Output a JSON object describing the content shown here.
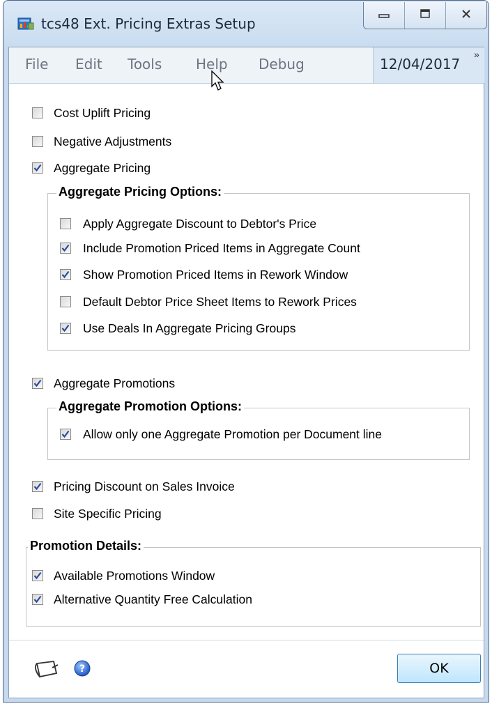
{
  "window": {
    "title": "tcs48 Ext. Pricing Extras Setup",
    "icon": "pricing-app-icon"
  },
  "menu": {
    "items": [
      "File",
      "Edit",
      "Tools",
      "Help",
      "Debug"
    ],
    "date": "12/04/2017",
    "overflow": "»"
  },
  "options": {
    "cost_uplift": {
      "label": "Cost Uplift Pricing",
      "checked": false
    },
    "negative_adjustments": {
      "label": "Negative Adjustments",
      "checked": false
    },
    "aggregate_pricing": {
      "label": "Aggregate Pricing",
      "checked": true
    }
  },
  "aggregate_pricing_options": {
    "title": "Aggregate Pricing Options:",
    "items": [
      {
        "label": "Apply Aggregate Discount to Debtor's Price",
        "checked": false
      },
      {
        "label": "Include Promotion Priced Items in Aggregate Count",
        "checked": true
      },
      {
        "label": "Show Promotion Priced Items in Rework Window",
        "checked": true
      },
      {
        "label": "Default Debtor Price Sheet Items to Rework Prices",
        "checked": false
      },
      {
        "label": "Use Deals In Aggregate Pricing Groups",
        "checked": true
      }
    ]
  },
  "aggregate_promotions": {
    "label": "Aggregate Promotions",
    "checked": true
  },
  "aggregate_promotion_options": {
    "title": "Aggregate Promotion Options:",
    "items": [
      {
        "label": "Allow only one Aggregate Promotion per Document line",
        "checked": true
      }
    ]
  },
  "more_options": {
    "pricing_discount": {
      "label": "Pricing Discount on Sales Invoice",
      "checked": true
    },
    "site_specific": {
      "label": "Site Specific Pricing",
      "checked": false
    }
  },
  "promotion_details": {
    "title": "Promotion Details:",
    "items": [
      {
        "label": "Available Promotions Window",
        "checked": true
      },
      {
        "label": "Alternative Quantity Free Calculation",
        "checked": true
      }
    ]
  },
  "footer": {
    "ok_label": "OK",
    "note_icon": "note-icon",
    "help_icon": "help-icon"
  },
  "colors": {
    "accent": "#3c7fb1",
    "check": "#2a4c9c",
    "titlebar": "#c9dcf0"
  }
}
